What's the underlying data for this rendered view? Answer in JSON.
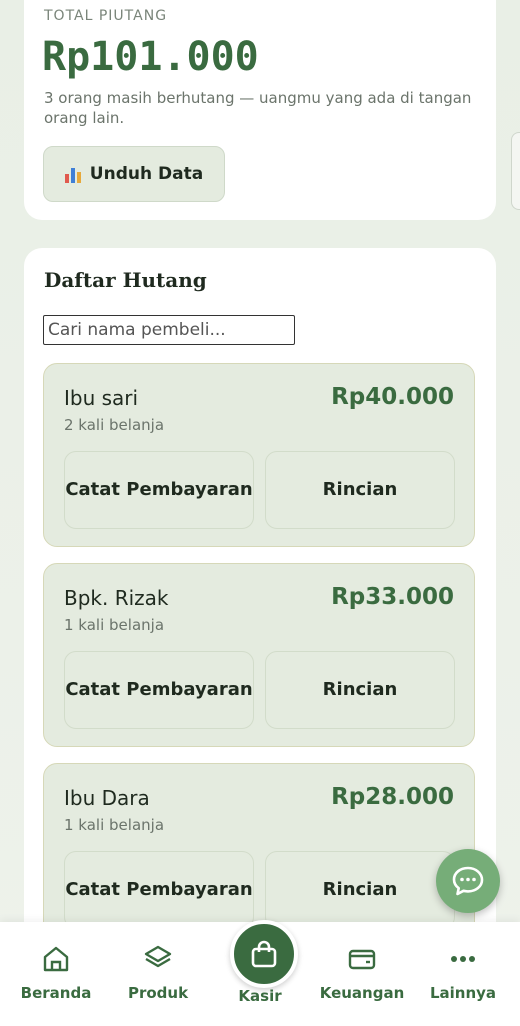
{
  "summary": {
    "label": "TOTAL PIUTANG",
    "amount": "Rp101.000",
    "description": "3 orang masih berhutang — uangmu yang ada di tangan orang lain.",
    "download_label": "Unduh Data",
    "download_icon": "bar-chart-icon"
  },
  "list": {
    "title": "Daftar Hutang",
    "search_placeholder": "Cari nama pembeli...",
    "items": [
      {
        "name": "Ibu sari",
        "count": "2 kali belanja",
        "amount": "Rp40.000",
        "pay_label": "Catat Pembayaran",
        "detail_label": "Rincian"
      },
      {
        "name": "Bpk. Rizak",
        "count": "1 kali belanja",
        "amount": "Rp33.000",
        "pay_label": "Catat Pembayaran",
        "detail_label": "Rincian"
      },
      {
        "name": "Ibu Dara",
        "count": "1 kali belanja",
        "amount": "Rp28.000",
        "pay_label": "Catat Pembayaran",
        "detail_label": "Rincian"
      }
    ]
  },
  "nav": {
    "items": [
      {
        "label": "Beranda",
        "icon": "home-icon"
      },
      {
        "label": "Produk",
        "icon": "box-icon"
      },
      {
        "label": "Kasir",
        "icon": "shopping-bag-icon"
      },
      {
        "label": "Keuangan",
        "icon": "wallet-icon"
      },
      {
        "label": "Lainnya",
        "icon": "more-icon"
      }
    ]
  },
  "colors": {
    "accent": "#3a6b40",
    "card_bg": "#e4ebdf",
    "chat_fab": "#76ad78"
  }
}
